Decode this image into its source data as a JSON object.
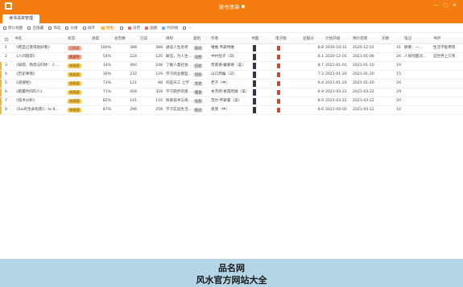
{
  "window": {
    "title": "读书清单",
    "controls": "— ▢ ✕"
  },
  "tab": {
    "label": "读书清单管理"
  },
  "toolbar": [
    {
      "label": "默认视图",
      "icon": "plus-icon"
    },
    {
      "label": "已隐藏",
      "icon": "eye-icon"
    },
    {
      "label": "筛选",
      "icon": "filter-icon"
    },
    {
      "label": "分组",
      "icon": "group-icon"
    },
    {
      "label": "排序",
      "icon": "sort-icon"
    },
    {
      "label": "填色",
      "icon": "paint-icon"
    },
    {
      "label": "",
      "icon": "row-height-icon"
    },
    {
      "label": "日历",
      "icon": "calendar-icon"
    },
    {
      "label": "画册",
      "icon": "gallery-icon"
    },
    {
      "label": "时间线",
      "icon": "timeline-icon"
    },
    {
      "label": "…",
      "icon": "more-icon"
    }
  ],
  "columns": [
    "书名",
    "状态",
    "进度",
    "总页数",
    "已读",
    "目标",
    "类别",
    "作者",
    "书面",
    "电子版",
    "豆瓣分",
    "计划开始",
    "预计结束",
    "天数",
    "笔记",
    "书评"
  ],
  "rows": [
    {
      "id": "1",
      "title": "《把自己变得很好看》",
      "status": "已阅读",
      "progress": "100%",
      "pages": "388",
      "read": "388",
      "goal": "通读人生思考",
      "cat": "励志",
      "author": "唯唯 韦斯特维",
      "score": "8.8",
      "start": "2020-10-31",
      "end": "2020-12-01",
      "days": "31",
      "note": "摘要：一...",
      "review": "生活不能用有"
    },
    {
      "id": "2",
      "title": "《人间值得》",
      "status": "阅读中",
      "progress": "54%",
      "pages": "224",
      "read": "120",
      "goal": "解压，为人生...",
      "cat": "治愈",
      "author": "中村恒子（日）",
      "score": "8.1",
      "start": "2020-12-01",
      "end": "2021-01-06",
      "days": "26",
      "note": "人如何面对...",
      "review": "这世界上只有"
    },
    {
      "id": "3",
      "title": "《知晓、熟悉与同体：人...",
      "status": "未阅读",
      "progress": "34%",
      "pages": "460",
      "read": "248",
      "goal": "了解人类社会...",
      "cat": "历史",
      "author": "贾雷德·戴蒙德（美）",
      "score": "8.7",
      "start": "2021-01-01",
      "end": "2021-01-10",
      "days": "19",
      "note": "",
      "review": ""
    },
    {
      "id": "4",
      "title": "《历史事情》",
      "status": "未阅读",
      "progress": "36%",
      "pages": "232",
      "read": "129",
      "goal": "学习商业模型...",
      "cat": "科技",
      "author": "山口周编（日）",
      "score": "7.3",
      "start": "2021-01-20",
      "end": "2021-01-20",
      "days": "15",
      "note": "",
      "review": ""
    },
    {
      "id": "5",
      "title": "《道德经》",
      "status": "未阅读",
      "progress": "73%",
      "pages": "121",
      "read": "88",
      "goal": "均是天工 之学",
      "cat": "文史",
      "author": "老子（中）",
      "score": "9.4",
      "start": "2021-01-20",
      "end": "2021-01-20",
      "days": "20",
      "note": "",
      "review": ""
    },
    {
      "id": "6",
      "title": "《跑赢时间的人》",
      "status": "未阅读",
      "progress": "71%",
      "pages": "458",
      "read": "328",
      "goal": "学习跑步的意...",
      "cat": "健身",
      "author": "本杰明·格雷厄姆（美）",
      "score": "8.9",
      "start": "2021-03-22",
      "end": "2021-03-22",
      "days": "29",
      "note": "",
      "review": ""
    },
    {
      "id": "7",
      "title": "《技术分析》",
      "status": "未阅读",
      "progress": "82%",
      "pages": "141",
      "read": "116",
      "goal": "探索技术与资...",
      "cat": "社科",
      "author": "范尔·怀斯曼（美）",
      "score": "8.9",
      "start": "2021-03-22",
      "end": "2021-03-22",
      "days": "20",
      "note": "",
      "review": ""
    },
    {
      "id": "8",
      "title": "《Sai的生命指南》：to 8...",
      "status": "未阅读",
      "progress": "87%",
      "pages": "296",
      "read": "258",
      "goal": "学习实战生活...",
      "cat": "励志",
      "author": "莫莫（中）",
      "score": "8.6",
      "start": "2021-04-02",
      "end": "2021-04-12",
      "days": "10",
      "note": "",
      "review": ""
    }
  ],
  "footer": {
    "line1": "品名网",
    "line2": "风水官方网站大全"
  },
  "colors": {
    "accent": "#f57d0f",
    "footer_bg": "#b3d5e6"
  }
}
